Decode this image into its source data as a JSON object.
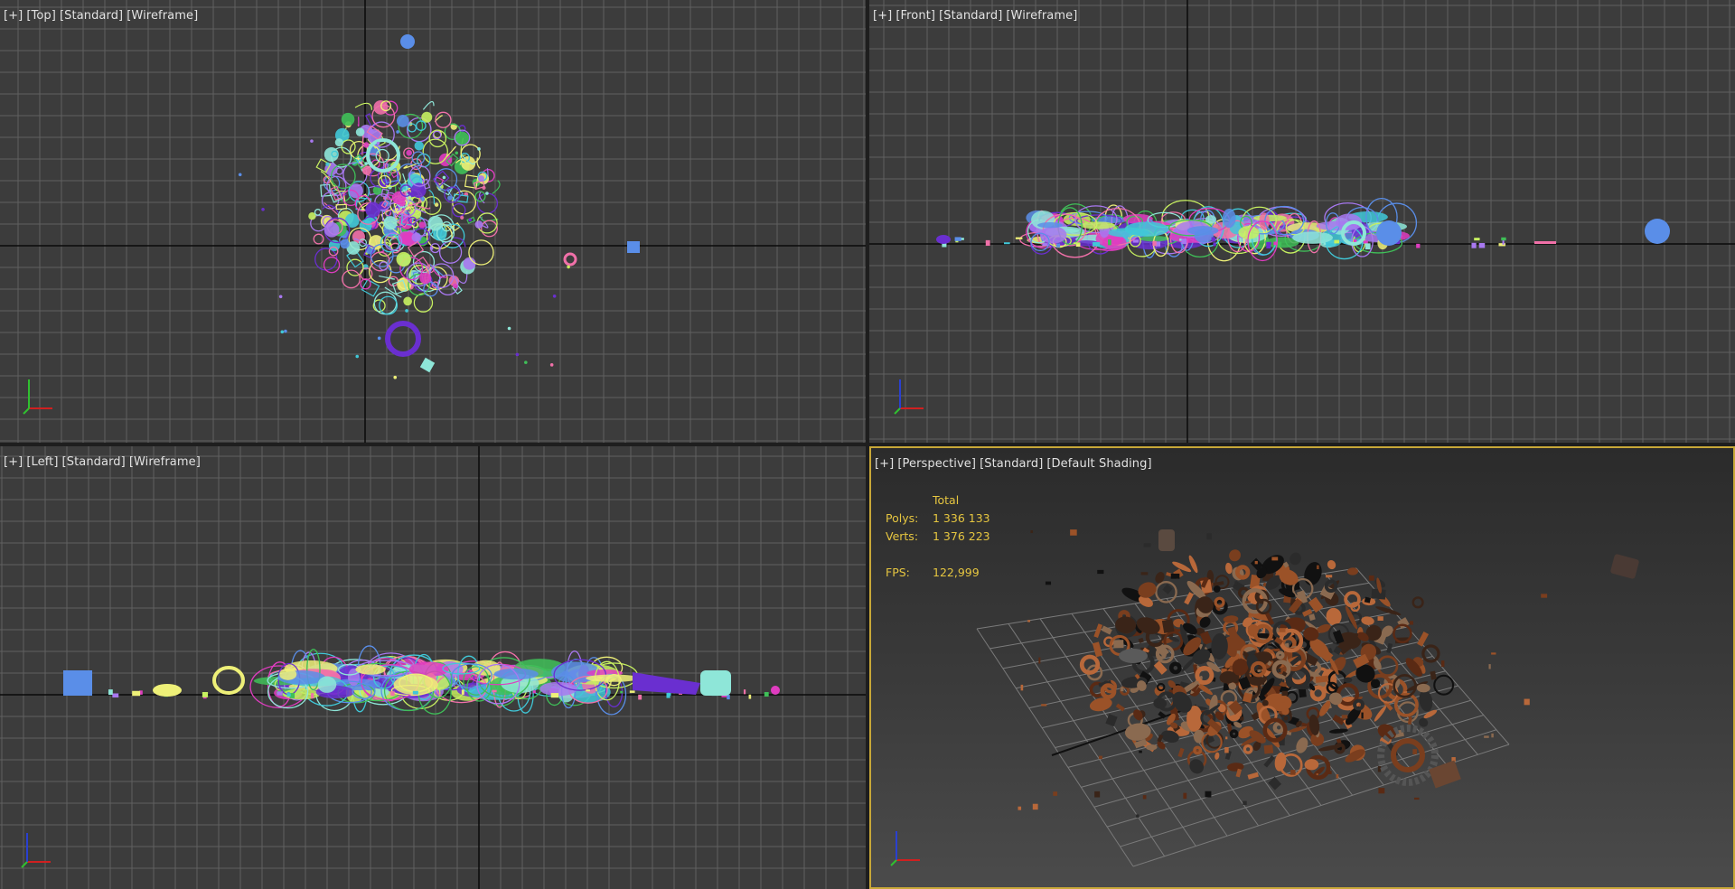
{
  "viewports": {
    "top": {
      "labels": [
        "[+]",
        "[Top]",
        "[Standard]",
        "[Wireframe]"
      ]
    },
    "front": {
      "labels": [
        "[+]",
        "[Front]",
        "[Standard]",
        "[Wireframe]"
      ]
    },
    "left": {
      "labels": [
        "[+]",
        "[Left]",
        "[Standard]",
        "[Wireframe]"
      ]
    },
    "perspective": {
      "labels": [
        "[+]",
        "[Perspective]",
        "[Standard]",
        "[Default Shading]"
      ],
      "stats": {
        "header": "Total",
        "polys_label": "Polys:",
        "polys_value": "1 336 133",
        "verts_label": "Verts:",
        "verts_value": "1 376 223",
        "fps_label": "FPS:",
        "fps_value": "122,999"
      }
    }
  },
  "colors": {
    "viewport_bg": "#3c3c3c",
    "grid_line": "#606060",
    "axis_line": "#0a0a0a",
    "active_border": "#c8a838",
    "stats_text": "#e6c640",
    "wire_palette": [
      "#c7f060",
      "#8ee6d8",
      "#6a2fd0",
      "#e03cc0",
      "#f070a8",
      "#5a8ee8",
      "#3fbf58",
      "#eef078",
      "#a878f0",
      "#40c8d8"
    ],
    "rust_palette": [
      "#7a3e1e",
      "#9b5228",
      "#5a2a14",
      "#3a2418",
      "#2b2b2b",
      "#8a6a50",
      "#b8683a",
      "#111111"
    ]
  },
  "icons": {
    "axis_gizmo": "axis-tripod-icon"
  }
}
